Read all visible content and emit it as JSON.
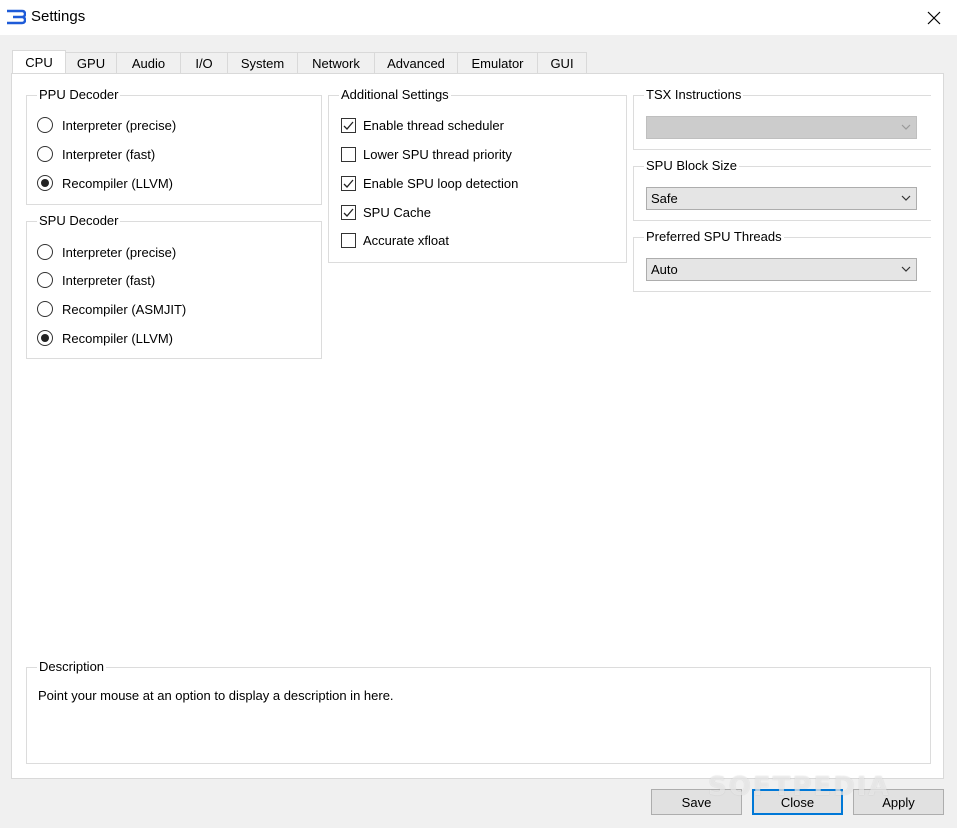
{
  "window": {
    "title": "Settings",
    "app_icon": "rpcs3-logo-icon",
    "close_icon": "close-icon"
  },
  "tabs": [
    {
      "label": "CPU",
      "active": true
    },
    {
      "label": "GPU"
    },
    {
      "label": "Audio"
    },
    {
      "label": "I/O"
    },
    {
      "label": "System"
    },
    {
      "label": "Network"
    },
    {
      "label": "Advanced"
    },
    {
      "label": "Emulator"
    },
    {
      "label": "GUI"
    }
  ],
  "ppu_decoder": {
    "title": "PPU Decoder",
    "options": [
      {
        "label": "Interpreter (precise)",
        "selected": false
      },
      {
        "label": "Interpreter (fast)",
        "selected": false
      },
      {
        "label": "Recompiler (LLVM)",
        "selected": true
      }
    ]
  },
  "spu_decoder": {
    "title": "SPU Decoder",
    "options": [
      {
        "label": "Interpreter (precise)",
        "selected": false
      },
      {
        "label": "Interpreter (fast)",
        "selected": false
      },
      {
        "label": "Recompiler (ASMJIT)",
        "selected": false
      },
      {
        "label": "Recompiler (LLVM)",
        "selected": true
      }
    ]
  },
  "additional_settings": {
    "title": "Additional Settings",
    "options": [
      {
        "label": "Enable thread scheduler",
        "checked": true
      },
      {
        "label": "Lower SPU thread priority",
        "checked": false
      },
      {
        "label": "Enable SPU loop detection",
        "checked": true
      },
      {
        "label": "SPU Cache",
        "checked": true
      },
      {
        "label": "Accurate xfloat",
        "checked": false
      }
    ]
  },
  "tsx_instructions": {
    "title": "TSX Instructions",
    "value": "",
    "disabled": true
  },
  "spu_block_size": {
    "title": "SPU Block Size",
    "value": "Safe"
  },
  "preferred_spu_threads": {
    "title": "Preferred SPU Threads",
    "value": "Auto"
  },
  "description": {
    "title": "Description",
    "text": "Point your mouse at an option to display a description in here."
  },
  "buttons": {
    "save": "Save",
    "close": "Close",
    "apply": "Apply"
  },
  "watermark": "SOFTPEDIA",
  "colors": {
    "accent": "#0078d7",
    "panel": "#ffffff",
    "window": "#f0f0f0"
  }
}
